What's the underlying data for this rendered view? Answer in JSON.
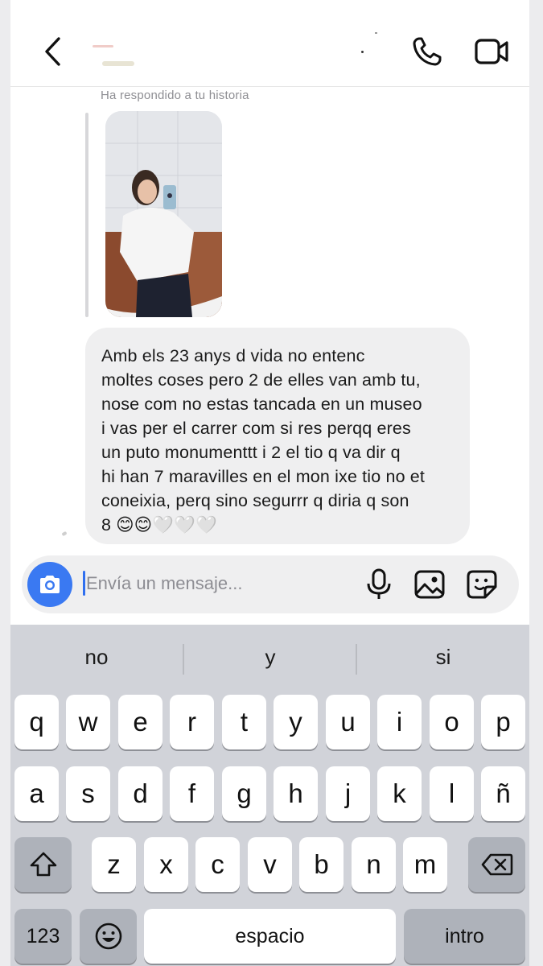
{
  "header": {
    "back_icon": "chevron-left-icon",
    "contact_name": "",
    "phone_icon": "phone-icon",
    "video_icon": "video-camera-icon"
  },
  "chat": {
    "reply_note": "Ha respondido a tu historia",
    "message": "Amb els 23 anys d vida no entenc\nmoltes coses pero 2 de elles van amb tu,\nnose com no estas tancada en un museo\ni vas per el carrer com si res perqq eres\nun puto monumenttt i 2 el tio q va dir q\nhi han 7 maravilles en el mon ixe tio no et\nconeixia, perq sino segurrr q diria q son\n8 😊😊🤍🤍🤍"
  },
  "composer": {
    "placeholder": "Envía un mensaje...",
    "camera_icon": "camera-icon",
    "mic_icon": "microphone-icon",
    "gallery_icon": "image-icon",
    "sticker_icon": "sticker-icon",
    "accent": "#3a79f2"
  },
  "keyboard": {
    "suggestions": [
      "no",
      "y",
      "si"
    ],
    "row1": [
      "q",
      "w",
      "e",
      "r",
      "t",
      "y",
      "u",
      "i",
      "o",
      "p"
    ],
    "row2": [
      "a",
      "s",
      "d",
      "f",
      "g",
      "h",
      "j",
      "k",
      "l",
      "ñ"
    ],
    "row3": [
      "z",
      "x",
      "c",
      "v",
      "b",
      "n",
      "m"
    ],
    "shift_icon": "shift-icon",
    "delete_icon": "backspace-icon",
    "numbers_label": "123",
    "emoji_icon": "emoji-icon",
    "space_label": "espacio",
    "return_label": "intro"
  }
}
